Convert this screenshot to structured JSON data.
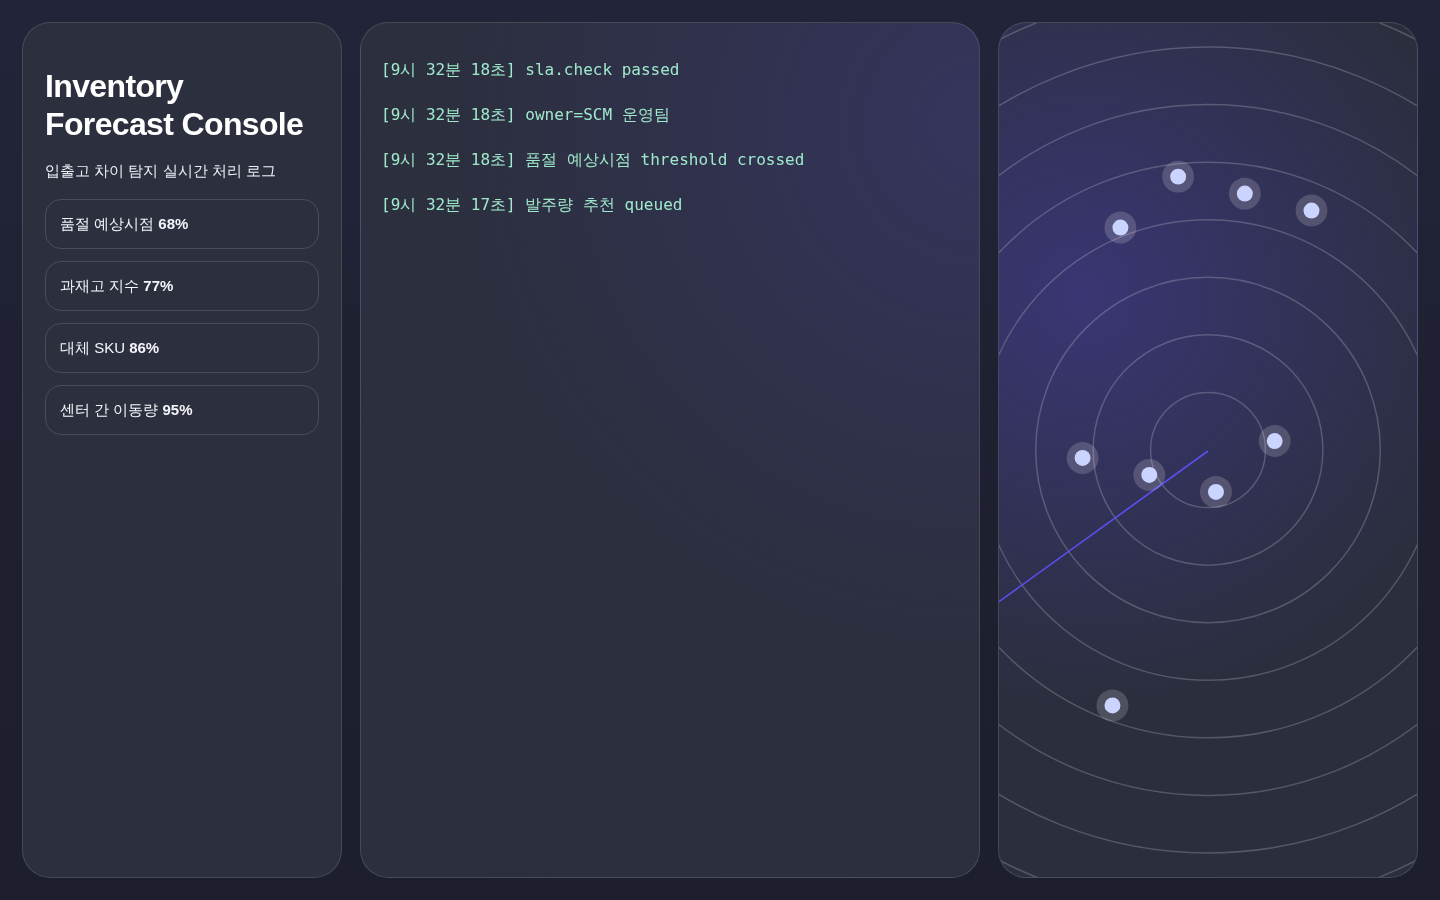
{
  "sidebar": {
    "title": "Inventory Forecast Console",
    "subtitle": "입출고 차이 탐지 실시간 처리 로그",
    "metrics": [
      {
        "text": "품절 예상시점 **68%**"
      },
      {
        "text": "과재고 지수 **77%**"
      },
      {
        "text": "대체 SKU **86%**"
      },
      {
        "text": "센터 간 이동량 **95%**"
      }
    ]
  },
  "log": {
    "lines": [
      "[9시 32분 18초] sla.check passed",
      "[9시 32분 18초] owner=SCM 운영팀",
      "[9시 32분 18초] 품절 예상시점 threshold crossed",
      "[9시 32분 17초] 발주량 추천 queued"
    ]
  }
}
